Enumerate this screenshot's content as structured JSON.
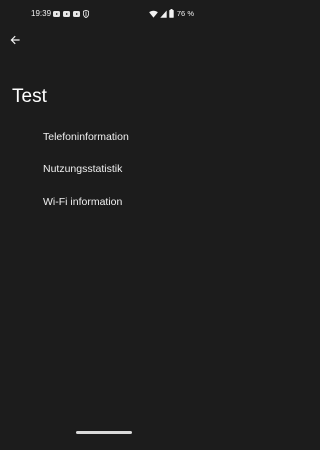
{
  "status_bar": {
    "time": "19:39",
    "battery_percent": "76 %",
    "left_icons": [
      "youtube-icon",
      "youtube-icon",
      "youtube-icon",
      "shield-icon"
    ],
    "right_icons": [
      "wifi-icon",
      "signal-icon",
      "battery-icon"
    ]
  },
  "toolbar": {
    "back_icon": "arrow-left-icon"
  },
  "page": {
    "title": "Test"
  },
  "menu": {
    "items": [
      {
        "label": "Telefoninformation"
      },
      {
        "label": "Nutzungsstatistik"
      },
      {
        "label": "Wi-Fi information"
      }
    ]
  },
  "colors": {
    "background": "#1c1c1c",
    "text": "#ffffff",
    "gesture_bar": "#d9d9d9"
  }
}
